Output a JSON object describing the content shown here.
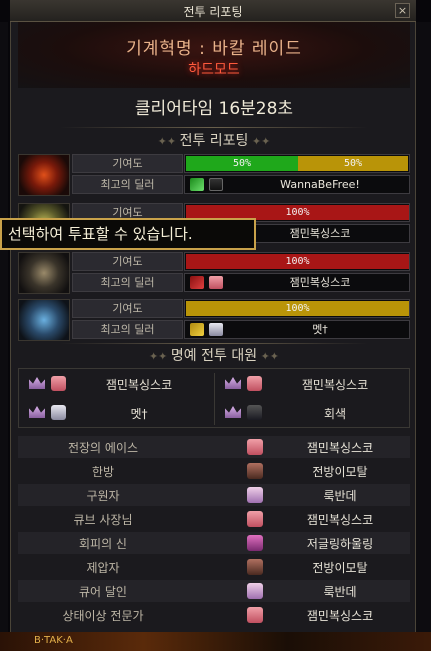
{
  "window": {
    "title": "전투 리포팅",
    "close_label": "×"
  },
  "raid": {
    "name": "기계혁명 : 바칼 레이드",
    "mode": "하드모드",
    "clear_time": "클리어타임  16분28초"
  },
  "report_section": {
    "title": "전투 리포팅",
    "contribution_label": "기여도",
    "top_dealer_label": "최고의 딜러"
  },
  "bosses": [
    {
      "contribution": [
        {
          "text": "50%",
          "value": 50,
          "color": "#1fa81b"
        },
        {
          "text": "50%",
          "value": 50,
          "color": "#b99408"
        }
      ],
      "dealer": "WannaBeFree!",
      "icon": "green-sword-icon"
    },
    {
      "contribution": [
        {
          "text": "100%",
          "value": 100,
          "color": "#a81616"
        }
      ],
      "dealer": "잼민복싱스코",
      "icon": "red-sword-icon"
    },
    {
      "contribution": [
        {
          "text": "100%",
          "value": 100,
          "color": "#a81616"
        }
      ],
      "dealer": "잼민복싱스코",
      "icon": "red-sword-icon"
    },
    {
      "contribution": [
        {
          "text": "100%",
          "value": 100,
          "color": "#b99408"
        }
      ],
      "dealer": "멧†",
      "icon": "yellow-sword-icon"
    }
  ],
  "tooltip": {
    "text": "선택하여 투표할 수 있습니다."
  },
  "honor_section": {
    "title": "명예 전투 대원",
    "members": [
      "잼민복싱스코",
      "잼민복싱스코",
      "멧†",
      "회색"
    ]
  },
  "awards": [
    {
      "title": "전장의 에이스",
      "player": "잼민복싱스코"
    },
    {
      "title": "한방",
      "player": "전방이모탈"
    },
    {
      "title": "구원자",
      "player": "룩반데"
    },
    {
      "title": "큐브 사장님",
      "player": "잼민복싱스코"
    },
    {
      "title": "회피의 신",
      "player": "저글링하울링"
    },
    {
      "title": "제압자",
      "player": "전방이모탈"
    },
    {
      "title": "큐어 달인",
      "player": "룩반데"
    },
    {
      "title": "상태이상 전문가",
      "player": "잼민복싱스코"
    }
  ],
  "bottom_bar": {
    "left_text": "B·TAK·A"
  },
  "colors": {
    "accent_gold": "#c9a24a",
    "hard_mode_red": "#ff5a3c",
    "bar_green": "#1fa81b",
    "bar_red": "#a81616",
    "bar_yellow": "#b99408"
  }
}
